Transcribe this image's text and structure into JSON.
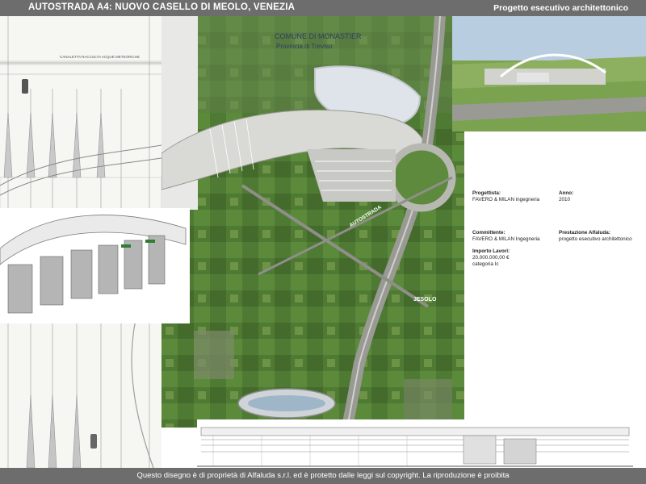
{
  "header": {
    "title": "AUTOSTRADA A4: NUOVO CASELLO DI MEOLO, VENEZIA",
    "subtitle": "Progetto esecutivo architettonico"
  },
  "map_labels": {
    "comune": "COMUNE DI MONASTIER",
    "provincia": "Provincia di Treviso",
    "autostrada": "AUTOSTRADA",
    "jesolo": "JESOLO"
  },
  "plan_labels": {
    "roadside": "CANALETTA RACCOLTA ACQUE METEORICHE"
  },
  "project_info": {
    "progettista_label": "Progettista:",
    "progettista_value": "FAVERO & MILAN ingegneria",
    "anno_label": "Anno:",
    "anno_value": "2010",
    "committente_label": "Committente:",
    "committente_value": "FAVERO & MILAN Ingegneria",
    "prestazione_label": "Prestazione Alfaluda:",
    "prestazione_value": "progetto esecutivo architettonico",
    "importo_label": "Importo Lavori:",
    "importo_value": "20.000.000,00 €",
    "categoria_value": "categoria  Ic"
  },
  "footer": {
    "copyright": "Questo disegno è di proprietà di Alfaluda s.r.l. ed è protetto dalle leggi sul copyright.  La riproduzione è proibita"
  },
  "colors": {
    "header_bg": "#6d6d6d",
    "field_green": "#4f7a33",
    "road_gray": "#9a9a95",
    "sky_blue": "#b9cde0"
  }
}
